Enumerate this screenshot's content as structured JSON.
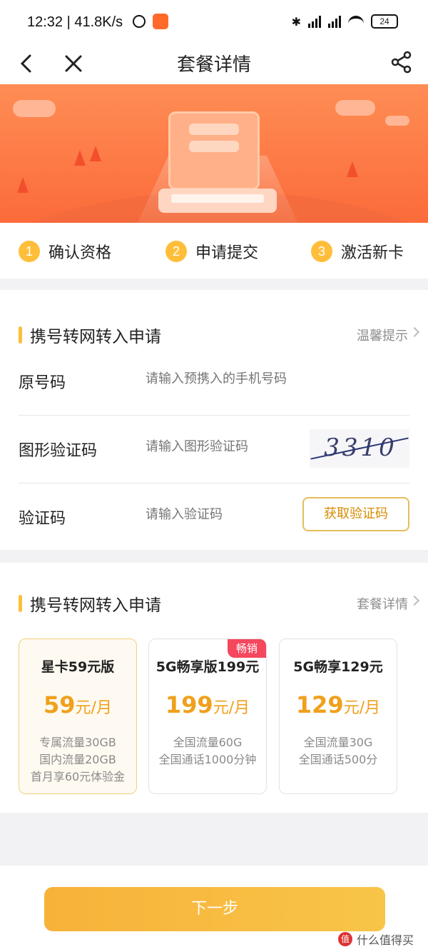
{
  "status_bar": {
    "time": "12:32 | 41.8K/s",
    "battery": "24"
  },
  "nav": {
    "title": "套餐详情"
  },
  "steps": [
    {
      "num": "1",
      "label": "确认资格"
    },
    {
      "num": "2",
      "label": "申请提交"
    },
    {
      "num": "3",
      "label": "激活新卡"
    }
  ],
  "form_section": {
    "title": "携号转网转入申请",
    "link": "温馨提示",
    "rows": [
      {
        "label": "原号码",
        "placeholder": "请输入预携入的手机号码"
      },
      {
        "label": "图形验证码",
        "placeholder": "请输入图形验证码",
        "captcha": "3310"
      },
      {
        "label": "验证码",
        "placeholder": "请输入验证码",
        "button": "获取验证码"
      }
    ]
  },
  "plan_section": {
    "title": "携号转网转入申请",
    "link": "套餐详情",
    "plans": [
      {
        "name": "星卡59元版",
        "price": "59",
        "unit": "元/月",
        "desc": [
          "专属流量30GB",
          "国内流量20GB",
          "首月享60元体验金"
        ],
        "selected": true
      },
      {
        "name": "5G畅享版199元",
        "price": "199",
        "unit": "元/月",
        "desc": [
          "全国流量60G",
          "全国通话1000分钟"
        ],
        "tag": "畅销"
      },
      {
        "name": "5G畅享129元",
        "price": "129",
        "unit": "元/月",
        "desc": [
          "全国流量30G",
          "全国通话500分"
        ]
      }
    ]
  },
  "next_button": "下一步",
  "watermark": {
    "badge": "值",
    "text": "什么值得买"
  },
  "colors": {
    "accent": "#ffbe3a",
    "banner": "#fb6b3a",
    "price": "#f0a01c",
    "hot_tag": "#f5475d"
  }
}
